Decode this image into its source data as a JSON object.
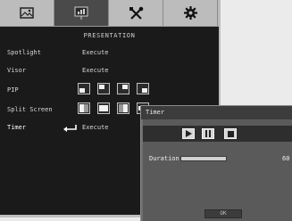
{
  "menu": {
    "tabs": [
      {
        "icon": "picture-icon"
      },
      {
        "icon": "presentation-icon"
      },
      {
        "icon": "tools-icon"
      },
      {
        "icon": "gear-icon"
      }
    ],
    "section_title": "PRESENTATION",
    "rows": [
      {
        "label": "Spotlight",
        "value": "Execute"
      },
      {
        "label": "Visor",
        "value": "Execute"
      },
      {
        "label": "PIP",
        "value": ""
      },
      {
        "label": "Split Screen",
        "value": ""
      },
      {
        "label": "Timer",
        "value": "Execute"
      }
    ]
  },
  "timer_dialog": {
    "title": "Timer",
    "controls": [
      "play-icon",
      "pause-icon",
      "stop-icon"
    ],
    "duration_label": "Duration",
    "duration_value": "60",
    "duration_fraction": 1.0,
    "ok_label": "OK"
  }
}
